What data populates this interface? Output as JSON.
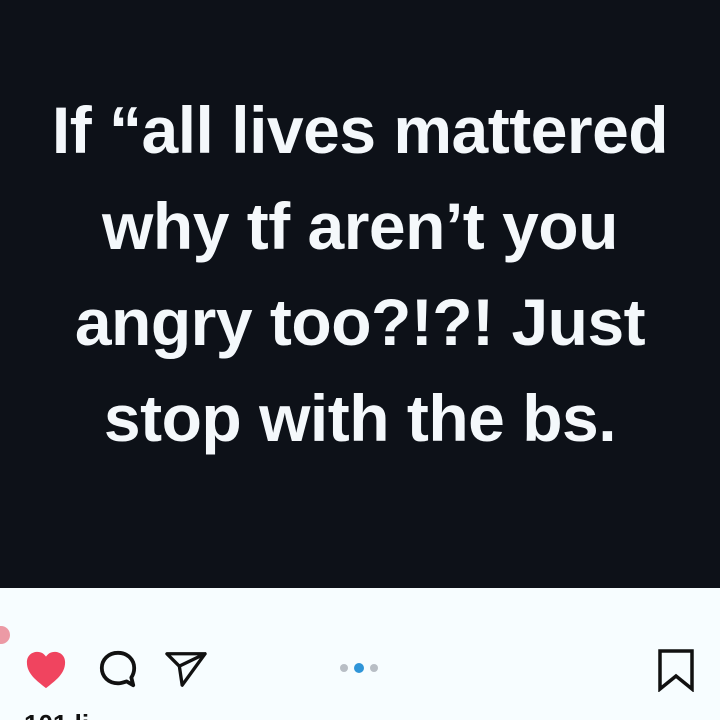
{
  "post": {
    "text_lines": [
      "If “all lives mattered",
      "why tf aren’t you",
      "angry too?!?! Just",
      "stop with the bs."
    ]
  },
  "actions": {
    "carousel": {
      "count": 3,
      "active_index": 1
    },
    "likes_partial": "101 li"
  },
  "colors": {
    "post_background": "#0d1118",
    "post_text": "#f4f8fb",
    "like": "#f0445f",
    "icon": "#111111",
    "active_dot": "#2f95d8",
    "inactive_dot": "#b8bec5"
  },
  "icons": [
    "heart-icon",
    "comment-icon",
    "share-icon",
    "bookmark-icon"
  ]
}
